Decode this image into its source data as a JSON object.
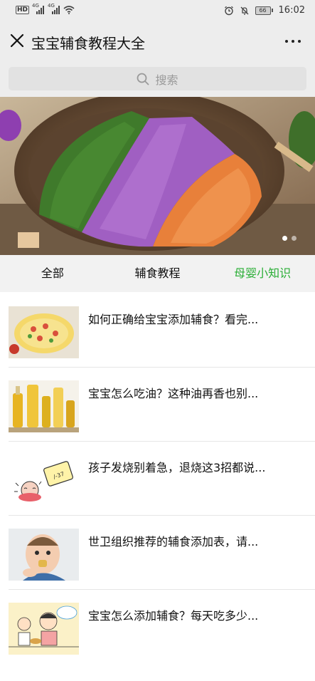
{
  "status": {
    "network": "4G",
    "network2": "4G",
    "battery": "66",
    "time": "16:02"
  },
  "header": {
    "title": "宝宝辅食教程大全"
  },
  "search": {
    "placeholder": "搜索"
  },
  "banner": {
    "slides": 2,
    "active": 1
  },
  "tabs": [
    {
      "label": "全部",
      "active": false
    },
    {
      "label": "辅食教程",
      "active": false
    },
    {
      "label": "母婴小知识",
      "active": true
    }
  ],
  "articles": [
    {
      "title": "如何正确给宝宝添加辅食？看完..."
    },
    {
      "title": "宝宝怎么吃油？这种油再香也别..."
    },
    {
      "title": "孩子发烧别着急，退烧这3招都说..."
    },
    {
      "title": "世卫组织推荐的辅食添加表，请..."
    },
    {
      "title": "宝宝怎么添加辅食？每天吃多少..."
    }
  ],
  "colors": {
    "accent": "#2aae36",
    "header_bg": "#ededed"
  }
}
